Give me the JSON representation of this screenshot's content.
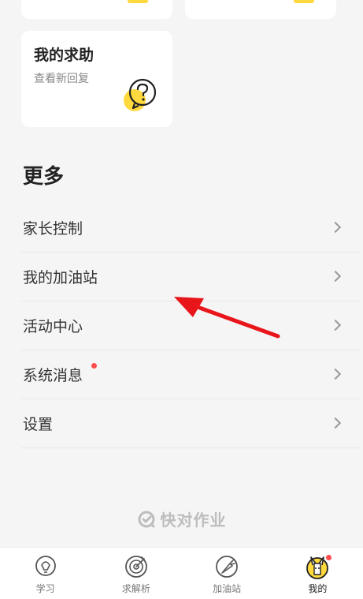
{
  "help_card": {
    "title": "我的求助",
    "subtitle": "查看新回复"
  },
  "section": {
    "title": "更多"
  },
  "menu": {
    "items": [
      {
        "label": "家长控制"
      },
      {
        "label": "我的加油站"
      },
      {
        "label": "活动中心"
      },
      {
        "label": "系统消息"
      },
      {
        "label": "设置"
      }
    ]
  },
  "brand": {
    "name": "快对作业"
  },
  "tabbar": {
    "tabs": [
      {
        "label": "学习"
      },
      {
        "label": "求解析"
      },
      {
        "label": "加油站"
      },
      {
        "label": "我的"
      }
    ]
  },
  "colors": {
    "accent_yellow": "#ffd93d",
    "badge_red": "#ff4d4f",
    "annotation_arrow": "#e8161b"
  }
}
